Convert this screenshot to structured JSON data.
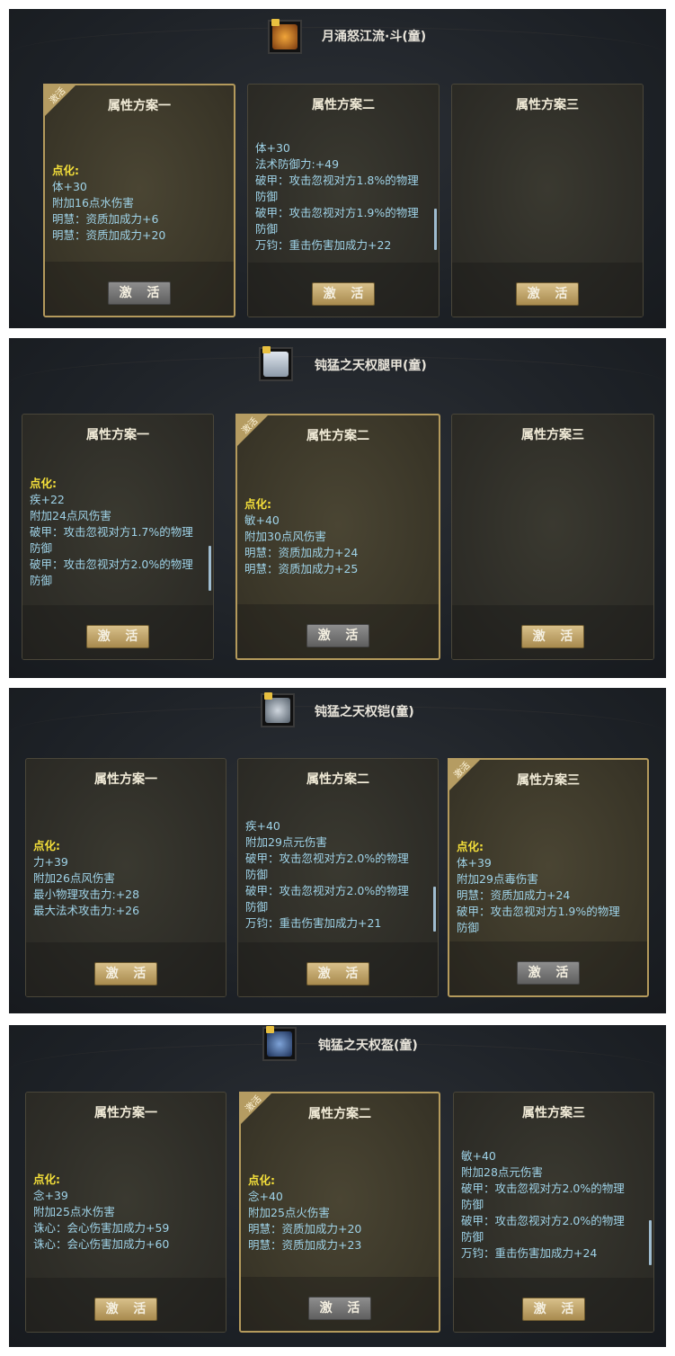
{
  "active_label": "激活",
  "panels": [
    {
      "title": "月涌怒江流·斗(童)",
      "cards": [
        {
          "header": "属性方案一",
          "lines": [
            "点化:",
            "体+30",
            "附加16点水伤害",
            "明慧：资质加成力+6",
            "明慧：资质加成力+20"
          ],
          "button": "激 活"
        },
        {
          "header": "属性方案二",
          "lines": [
            "体+30",
            "法术防御力:+49",
            "破甲：攻击忽视对方1.8%的物理",
            "防御",
            "破甲：攻击忽视对方1.9%的物理",
            "防御",
            "万钧：重击伤害加成力+22"
          ],
          "button": "激 活"
        },
        {
          "header": "属性方案三",
          "lines": [],
          "button": "激 活"
        }
      ]
    },
    {
      "title": "钝猛之天权腿甲(童)",
      "cards": [
        {
          "header": "属性方案一",
          "lines": [
            "点化:",
            "疾+22",
            "附加24点风伤害",
            "破甲：攻击忽视对方1.7%的物理",
            "防御",
            "破甲：攻击忽视对方2.0%的物理",
            "防御"
          ],
          "button": "激 活"
        },
        {
          "header": "属性方案二",
          "lines": [
            "点化:",
            "敏+40",
            "附加30点风伤害",
            "明慧：资质加成力+24",
            "明慧：资质加成力+25"
          ],
          "button": "激 活"
        },
        {
          "header": "属性方案三",
          "lines": [],
          "button": "激 活"
        }
      ]
    },
    {
      "title": "钝猛之天权铠(童)",
      "cards": [
        {
          "header": "属性方案一",
          "lines": [
            "点化:",
            "力+39",
            "附加26点风伤害",
            "最小物理攻击力:+28",
            "最大法术攻击力:+26"
          ],
          "button": "激 活"
        },
        {
          "header": "属性方案二",
          "lines": [
            "疾+40",
            "附加29点元伤害",
            "破甲：攻击忽视对方2.0%的物理",
            "防御",
            "破甲：攻击忽视对方2.0%的物理",
            "防御",
            "万钧：重击伤害加成力+21"
          ],
          "button": "激 活"
        },
        {
          "header": "属性方案三",
          "lines": [
            "点化:",
            "体+39",
            "附加29点毒伤害",
            "明慧：资质加成力+24",
            "破甲：攻击忽视对方1.9%的物理",
            "防御"
          ],
          "button": "激 活"
        }
      ]
    },
    {
      "title": "钝猛之天权盔(童)",
      "cards": [
        {
          "header": "属性方案一",
          "lines": [
            "点化:",
            "念+39",
            "附加25点水伤害",
            "诛心：会心伤害加成力+59",
            "诛心：会心伤害加成力+60"
          ],
          "button": "激 活"
        },
        {
          "header": "属性方案二",
          "lines": [
            "点化:",
            "念+40",
            "附加25点火伤害",
            "明慧：资质加成力+20",
            "明慧：资质加成力+23"
          ],
          "button": "激 活"
        },
        {
          "header": "属性方案三",
          "lines": [
            "敏+40",
            "附加28点元伤害",
            "破甲：攻击忽视对方2.0%的物理",
            "防御",
            "破甲：攻击忽视对方2.0%的物理",
            "防御",
            "万钧：重击伤害加成力+24"
          ],
          "button": "激 活"
        }
      ]
    }
  ]
}
